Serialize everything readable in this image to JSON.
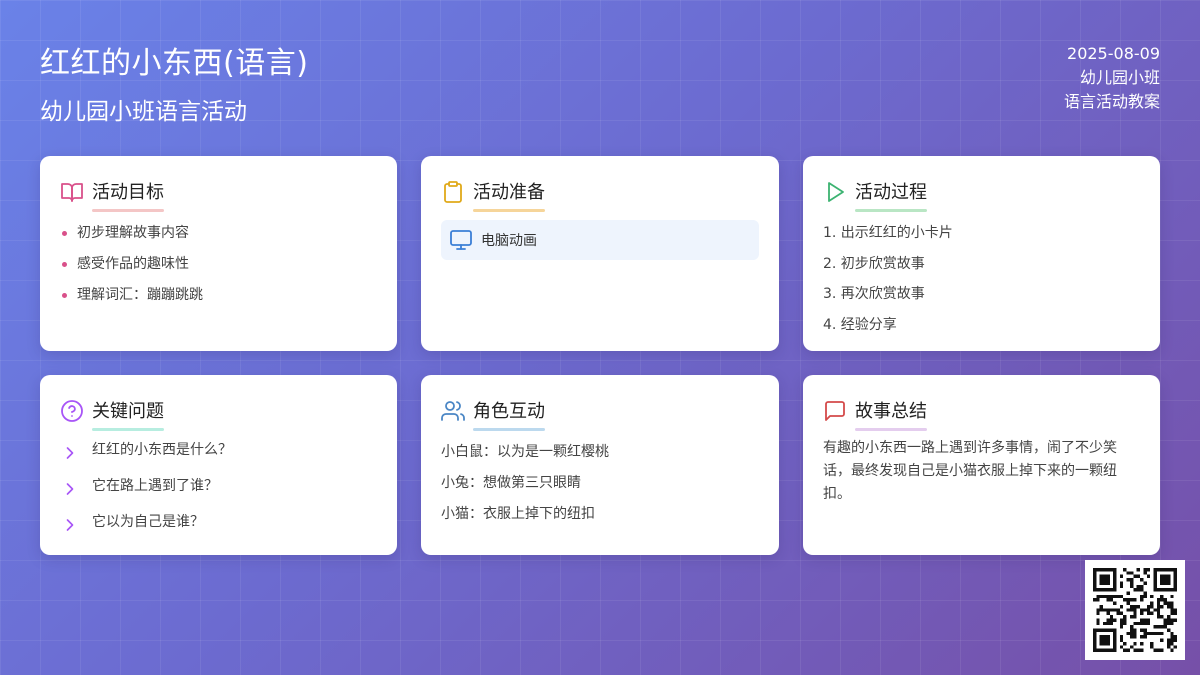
{
  "header": {
    "title": "红红的小东西(语言)",
    "subtitle": "幼儿园小班语言活动",
    "date": "2025-08-09",
    "class": "幼儿园小班",
    "type": "语言活动教案"
  },
  "cards": {
    "goals": {
      "title": "活动目标",
      "icon": "book-open-icon",
      "items": [
        "初步理解故事内容",
        "感受作品的趣味性",
        "理解词汇：蹦蹦跳跳"
      ]
    },
    "prep": {
      "title": "活动准备",
      "icon": "clipboard-icon",
      "items": [
        {
          "icon": "monitor-icon",
          "label": "电脑动画"
        }
      ]
    },
    "process": {
      "title": "活动过程",
      "icon": "play-icon",
      "items": [
        "1. 出示红红的小卡片",
        "2. 初步欣赏故事",
        "3. 再次欣赏故事",
        "4. 经验分享"
      ]
    },
    "questions": {
      "title": "关键问题",
      "icon": "help-circle-icon",
      "items": [
        "红红的小东西是什么？",
        "它在路上遇到了谁？",
        "它以为自己是谁？"
      ]
    },
    "roles": {
      "title": "角色互动",
      "icon": "users-icon",
      "items": [
        "小白鼠：以为是一颗红樱桃",
        "小兔：想做第三只眼睛",
        "小猫：衣服上掉下的纽扣"
      ]
    },
    "summary": {
      "title": "故事总结",
      "icon": "message-square-icon",
      "text": "有趣的小东西一路上遇到许多事情，闹了不少笑话，最终发现自己是小猫衣服上掉下来的一颗纽扣。"
    }
  },
  "colors": {
    "goals_icon": "#d9508a",
    "prep_icon": "#e0a91a",
    "process_icon": "#3cb371",
    "questions_icon": "#a855f7",
    "roles_icon": "#4a86c5",
    "summary_icon": "#d44a4a"
  }
}
